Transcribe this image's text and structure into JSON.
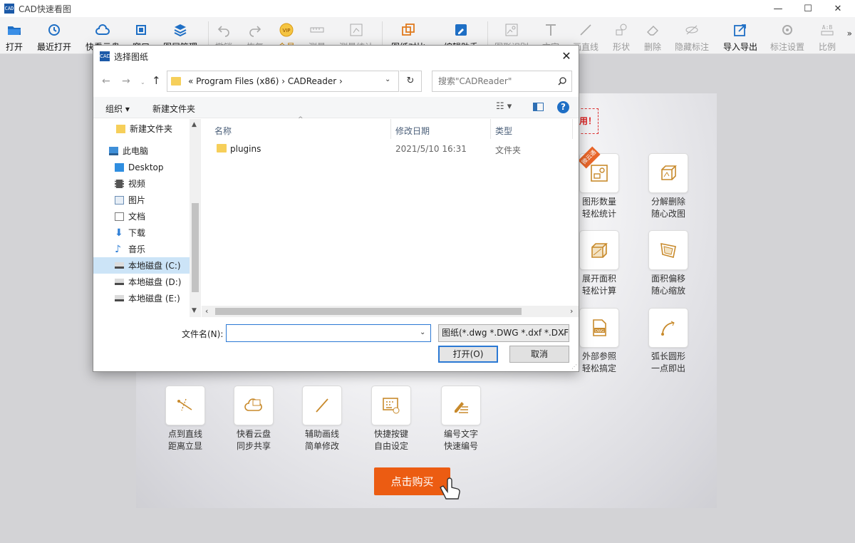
{
  "app": {
    "title": "CAD快速看图",
    "logo_text": "CAD"
  },
  "window_controls": {
    "minimize": "—",
    "maximize": "☐",
    "close": "✕"
  },
  "toolbar": {
    "items": [
      {
        "label": "打开",
        "icon": "folder-open-icon"
      },
      {
        "label": "最近打开",
        "icon": "clock-icon"
      },
      {
        "label": "快看云盘",
        "icon": "cloud-icon"
      },
      {
        "label": "窗口",
        "icon": "window-icon"
      },
      {
        "label": "图层管理",
        "icon": "layers-icon"
      },
      {
        "label": "撤销",
        "icon": "undo-icon"
      },
      {
        "label": "恢复",
        "icon": "redo-icon"
      },
      {
        "label": "会员",
        "icon": "vip-icon"
      },
      {
        "label": "测量",
        "icon": "ruler-icon"
      },
      {
        "label": "测量统计",
        "icon": "measure-stats-icon"
      },
      {
        "label": "图纸对比",
        "icon": "compare-icon"
      },
      {
        "label": "编辑助手",
        "icon": "edit-helper-icon"
      },
      {
        "label": "图形识别",
        "icon": "shape-recognize-icon"
      },
      {
        "label": "文字",
        "icon": "text-icon"
      },
      {
        "label": "画直线",
        "icon": "line-icon"
      },
      {
        "label": "形状",
        "icon": "shape-icon"
      },
      {
        "label": "删除",
        "icon": "eraser-icon"
      },
      {
        "label": "隐藏标注",
        "icon": "hide-icon"
      },
      {
        "label": "导入导出",
        "icon": "export-icon"
      },
      {
        "label": "标注设置",
        "icon": "settings-icon"
      },
      {
        "label": "比例",
        "icon": "scale-icon"
      }
    ],
    "more": "»"
  },
  "promo": {
    "tag": "用！",
    "hot_badge": "微云通",
    "features": [
      {
        "line1": "图形数量",
        "line2": "轻松统计",
        "icon": "shape-count-icon"
      },
      {
        "line1": "分解删除",
        "line2": "随心改图",
        "icon": "explode-icon"
      },
      {
        "line1": "展开面积",
        "line2": "轻松计算",
        "icon": "unfold-area-icon"
      },
      {
        "line1": "面积偏移",
        "line2": "随心缩放",
        "icon": "area-offset-icon"
      },
      {
        "line1": "外部参照",
        "line2": "轻松搞定",
        "icon": "dwg-xref-icon"
      },
      {
        "line1": "弧长圆形",
        "line2": "一点即出",
        "icon": "arc-length-icon"
      },
      {
        "line1": "点到直线",
        "line2": "距离立显",
        "icon": "point-line-icon"
      },
      {
        "line1": "快看云盘",
        "line2": "同步共享",
        "icon": "cloud-share-icon"
      },
      {
        "line1": "辅助画线",
        "line2": "简单修改",
        "icon": "assist-line-icon"
      },
      {
        "line1": "快捷按键",
        "line2": "自由设定",
        "icon": "keyboard-icon"
      },
      {
        "line1": "编号文字",
        "line2": "快速编号",
        "icon": "numbering-icon"
      }
    ],
    "buy_label": "点击购买"
  },
  "dialog": {
    "title": "选择图纸",
    "close": "✕",
    "nav": {
      "back": "←",
      "forward": "→",
      "recent": "⌄",
      "up": "↑"
    },
    "address": {
      "path": "«  Program Files (x86)  ›  CADReader  ›",
      "dropdown": "⌄"
    },
    "refresh": "↻",
    "search": {
      "placeholder": "搜索\"CADReader\""
    },
    "commands": {
      "organize": "组织 ▾",
      "new_folder": "新建文件夹",
      "view": "☷ ▾",
      "help": "?"
    },
    "tree": [
      {
        "label": "新建文件夹",
        "icon": "folder-icon",
        "level": 2
      },
      {
        "label": "此电脑",
        "icon": "computer-icon",
        "level": 1
      },
      {
        "label": "Desktop",
        "icon": "desktop-icon",
        "level": 2
      },
      {
        "label": "视频",
        "icon": "video-icon",
        "level": 2
      },
      {
        "label": "图片",
        "icon": "picture-icon",
        "level": 2
      },
      {
        "label": "文档",
        "icon": "document-icon",
        "level": 2
      },
      {
        "label": "下载",
        "icon": "download-icon",
        "level": 2
      },
      {
        "label": "音乐",
        "icon": "music-icon",
        "level": 2
      },
      {
        "label": "本地磁盘 (C:)",
        "icon": "drive-c-icon",
        "level": 2,
        "selected": true
      },
      {
        "label": "本地磁盘 (D:)",
        "icon": "drive-icon",
        "level": 2
      },
      {
        "label": "本地磁盘 (E:)",
        "icon": "drive-icon",
        "level": 2
      }
    ],
    "columns": {
      "name": "名称",
      "modified": "修改日期",
      "type": "类型"
    },
    "files": [
      {
        "name": "plugins",
        "modified": "2021/5/10 16:31",
        "type": "文件夹"
      }
    ],
    "filename_label": "文件名(N):",
    "filename_value": "",
    "filetype": "图纸(*.dwg *.DWG *.dxf *.DXF",
    "open_label": "打开(O)",
    "cancel_label": "取消"
  },
  "colors": {
    "accent": "#1f6fc5",
    "buy": "#ec5c12",
    "feature_icon": "#c88a2c",
    "selection": "#cce4f7"
  }
}
